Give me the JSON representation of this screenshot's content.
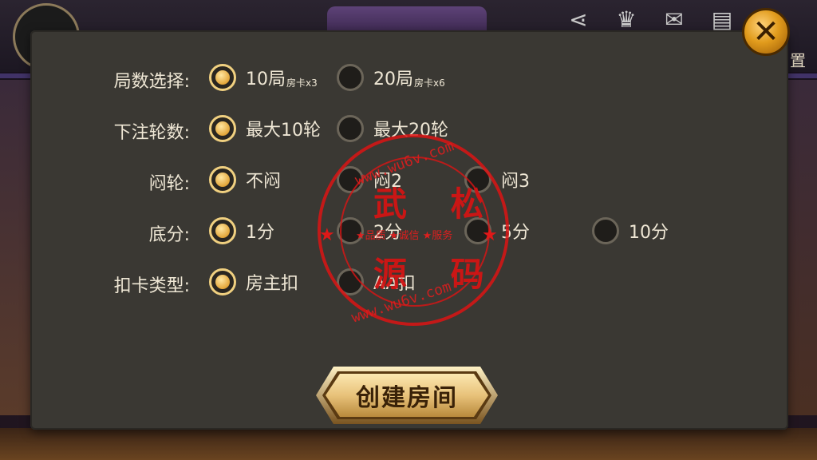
{
  "background": {
    "settings_label": "置"
  },
  "rows": [
    {
      "label": "局数选择:",
      "options": [
        {
          "text": "10局",
          "sub": "房卡x3",
          "selected": true
        },
        {
          "text": "20局",
          "sub": "房卡x6",
          "selected": false
        }
      ]
    },
    {
      "label": "下注轮数:",
      "options": [
        {
          "text": "最大10轮",
          "selected": true
        },
        {
          "text": "最大20轮",
          "selected": false
        }
      ]
    },
    {
      "label": "闷轮:",
      "options": [
        {
          "text": "不闷",
          "selected": true
        },
        {
          "text": "闷2",
          "selected": false
        },
        {
          "text": "闷3",
          "selected": false
        }
      ]
    },
    {
      "label": "底分:",
      "options": [
        {
          "text": "1分",
          "selected": true
        },
        {
          "text": "2分",
          "selected": false
        },
        {
          "text": "5分",
          "selected": false
        },
        {
          "text": "10分",
          "selected": false
        }
      ]
    },
    {
      "label": "扣卡类型:",
      "options": [
        {
          "text": "房主扣",
          "selected": true
        },
        {
          "text": "AA扣",
          "selected": false
        }
      ]
    }
  ],
  "create_button": {
    "label": "创建房间"
  },
  "close_button": {
    "label": "✕"
  },
  "watermark": {
    "top_url": "www.wu6v.com",
    "bottom_url": "www.wu6v.com",
    "line1": "武 松",
    "line2": "源 码",
    "slogan": "★品质 ★诚信 ★服务"
  },
  "colors": {
    "dialog_bg": "#3a3833",
    "text": "#efe7d5",
    "radio_selected": "#e3a63a",
    "button_gold": "#e8c27a",
    "close_orange": "#e19b1c",
    "watermark_red": "#d21414"
  }
}
